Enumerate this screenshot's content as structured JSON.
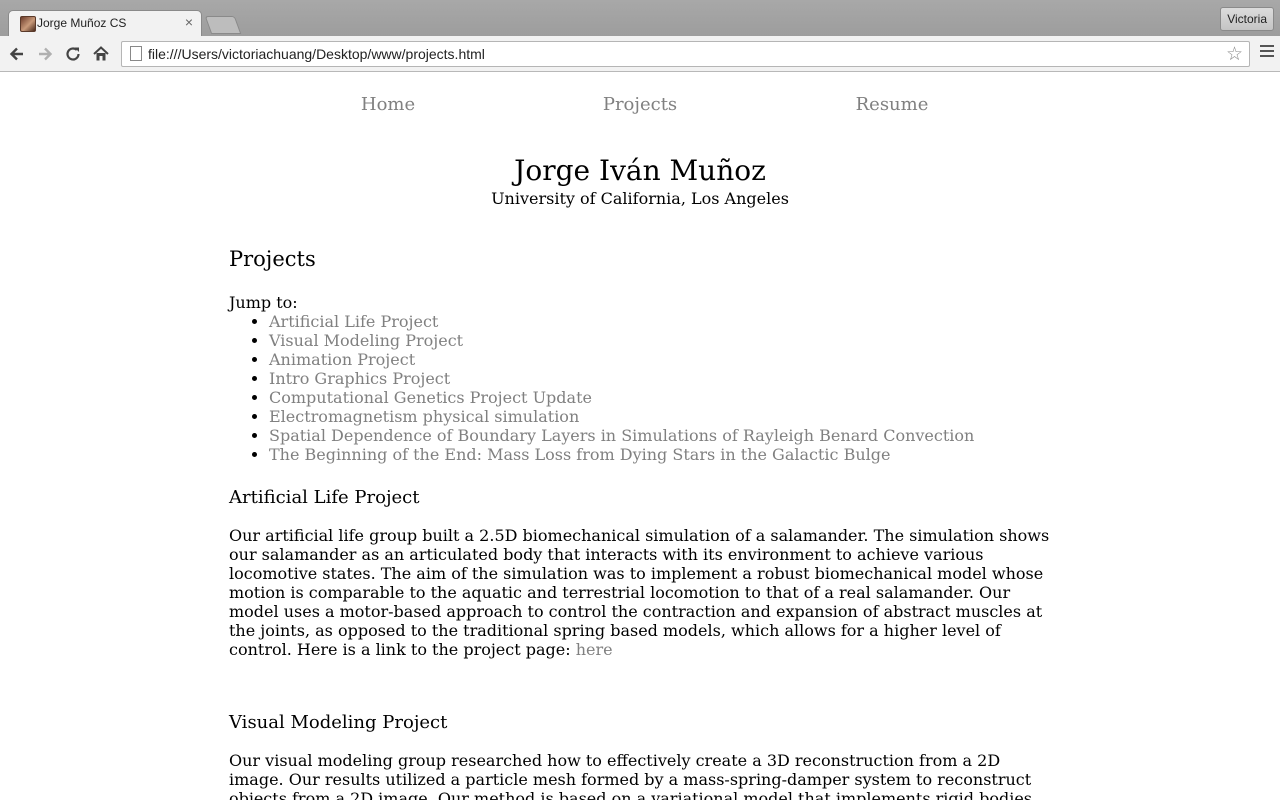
{
  "browser": {
    "tab_title": "Jorge Muñoz CS",
    "tab_close": "×",
    "profile_name": "Victoria",
    "url": "file:///Users/victoriachuang/Desktop/www/projects.html"
  },
  "site": {
    "nav": [
      {
        "label": "Home"
      },
      {
        "label": "Projects"
      },
      {
        "label": "Resume"
      }
    ],
    "name": "Jorge Iván Muñoz",
    "affiliation": "University of California, Los Angeles"
  },
  "projects": {
    "heading": "Projects",
    "jump_label": "Jump to:",
    "toc": [
      "Artificial Life Project",
      "Visual Modeling Project",
      "Animation Project",
      "Intro Graphics Project",
      "Computational Genetics Project Update",
      "Electromagnetism physical simulation",
      "Spatial Dependence of Boundary Layers in Simulations of Rayleigh Benard Convection",
      "The Beginning of the End: Mass Loss from Dying Stars in the Galactic Bulge"
    ],
    "sections": [
      {
        "title": "Artificial Life Project",
        "body": "Our artificial life group built a 2.5D biomechanical simulation of a salamander. The simulation shows our salamander as an articulated body that interacts with its environment to achieve various locomotive states. The aim of the simulation was to implement a robust biomechanical model whose motion is comparable to the aquatic and terrestrial locomotion to that of a real salamander. Our model uses a motor-based approach to control the contraction and expansion of abstract muscles at the joints, as opposed to the traditional spring based models, which allows for a higher level of control. Here is a link to the project page: ",
        "link": "here"
      },
      {
        "title": "Visual Modeling Project",
        "body": "Our visual modeling group researched how to effectively create a 3D reconstruction from a 2D image. Our results utilized a particle mesh formed by a mass-spring-damper system to reconstruct objects from a 2D image. Our method is based on a variational model that implements rigid bodies with a deformable mesh"
      }
    ]
  },
  "colors": {
    "link_gray": "#808080",
    "chrome_gray": "#a8a8a8"
  }
}
